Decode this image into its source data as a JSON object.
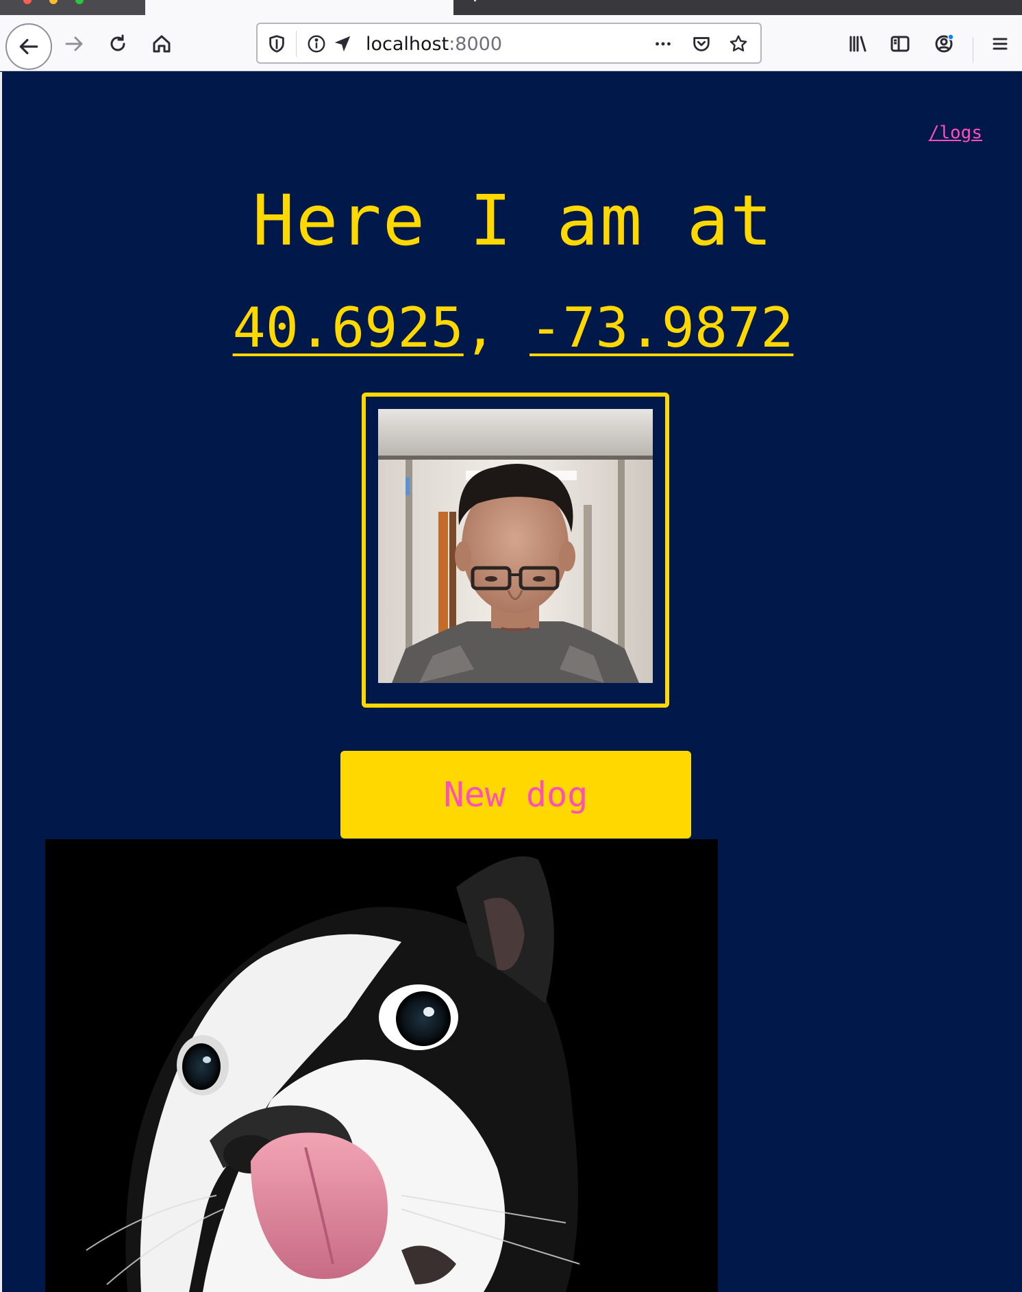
{
  "browser": {
    "url_host": "localhost",
    "url_port": ":8000",
    "colors": {
      "chrome_bg": "#f9f9fb",
      "tabstrip_bg": "#38383d"
    },
    "icons": [
      "back-arrow-icon",
      "forward-arrow-icon",
      "reload-icon",
      "home-icon",
      "shield-icon",
      "info-icon",
      "location-arrow-icon",
      "more-dots-icon",
      "pocket-icon",
      "bookmark-star-icon",
      "library-icon",
      "sidebar-icon",
      "account-icon",
      "hamburger-menu-icon"
    ]
  },
  "page": {
    "logs_link": "/logs",
    "heading": "Here I am at",
    "latitude": "40.6925",
    "separator": ", ",
    "longitude": "-73.9872",
    "new_dog_button": "New dog",
    "colors": {
      "background": "#00184a",
      "accent_yellow": "#ffd800",
      "accent_pink": "#ff4fb8"
    },
    "images": [
      "webcam-selfie",
      "dog-photo"
    ]
  }
}
